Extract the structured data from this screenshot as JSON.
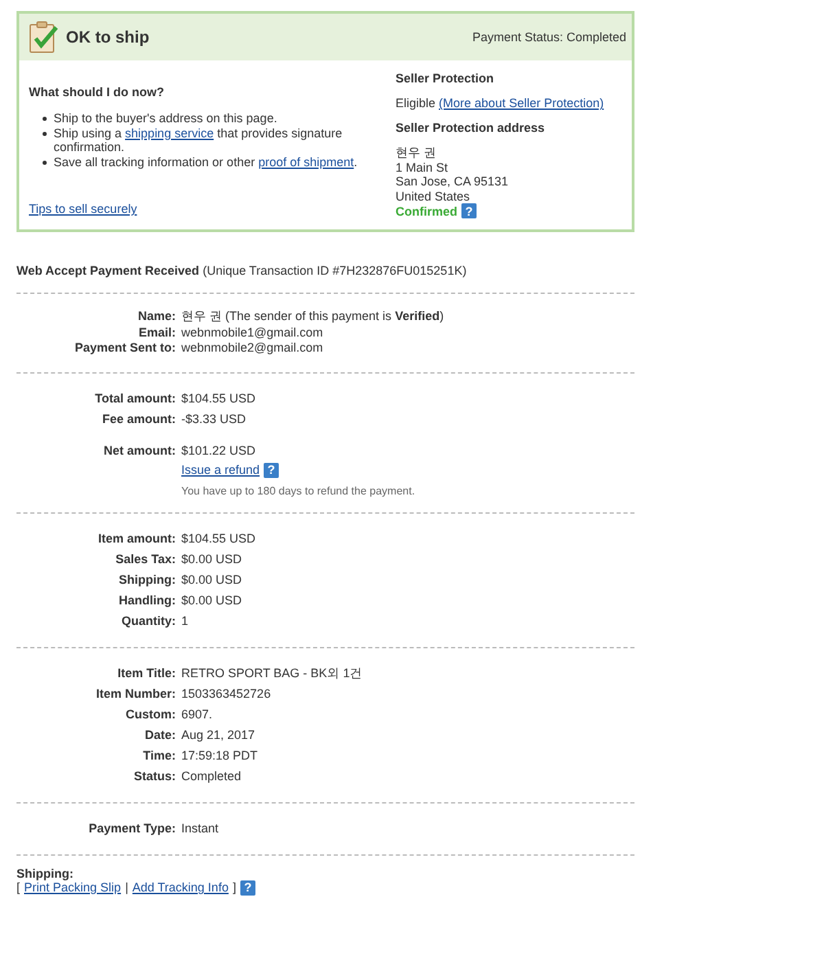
{
  "status_box": {
    "title": "OK to ship",
    "payment_status": "Payment Status: Completed",
    "question": "What should I do now?",
    "steps": [
      [
        {
          "kind": "text",
          "text": "Ship to the buyer's address on this page."
        }
      ],
      [
        {
          "kind": "text",
          "text": "Ship using a "
        },
        {
          "kind": "link",
          "text": "shipping service"
        },
        {
          "kind": "text",
          "text": " that provides signature confirmation."
        }
      ],
      [
        {
          "kind": "text",
          "text": "Save all tracking information or other "
        },
        {
          "kind": "link",
          "text": "proof of shipment"
        },
        {
          "kind": "text",
          "text": "."
        }
      ]
    ],
    "tips_link": "Tips to sell securely",
    "protection": {
      "heading": "Seller Protection",
      "status": "Eligible",
      "more_link": "(More about Seller Protection)",
      "address_heading": "Seller Protection address",
      "address_lines": [
        "현우 권",
        "1 Main St",
        "San Jose, CA 95131",
        "United States"
      ],
      "confirmed": "Confirmed",
      "help": "?"
    }
  },
  "transaction": {
    "title": "Web Accept Payment Received",
    "id_text": "(Unique Transaction ID #7H232876FU015251K)"
  },
  "sections": [
    {
      "groups": [
        [
          {
            "label": "Name:",
            "value": "현우 권 (The sender of this payment is **Verified**)"
          },
          {
            "label": "Email:",
            "value": "webnmobile1@gmail.com"
          },
          {
            "label": "Payment Sent to:",
            "value": "webnmobile2@gmail.com"
          }
        ]
      ],
      "compact": true
    },
    {
      "groups": [
        [
          {
            "label": "Total amount:",
            "value": "$104.55 USD"
          },
          {
            "label": "Fee amount:",
            "value": "-$3.33 USD"
          }
        ],
        [
          {
            "label": "Net amount:",
            "value": "$101.22 USD"
          }
        ]
      ],
      "refund": {
        "link": "Issue a refund",
        "help": "?",
        "note": "You have up to 180 days to refund the payment."
      }
    },
    {
      "groups": [
        [
          {
            "label": "Item amount:",
            "value": "$104.55 USD"
          },
          {
            "label": "Sales Tax:",
            "value": "$0.00 USD"
          },
          {
            "label": "Shipping:",
            "value": "$0.00 USD"
          },
          {
            "label": "Handling:",
            "value": "$0.00 USD"
          },
          {
            "label": "Quantity:",
            "value": "1"
          }
        ]
      ]
    },
    {
      "groups": [
        [
          {
            "label": "Item Title:",
            "value": "RETRO SPORT BAG - BK외 1건"
          },
          {
            "label": "Item Number:",
            "value": "1503363452726"
          },
          {
            "label": "Custom:",
            "value": "6907."
          },
          {
            "label": "Date:",
            "value": "Aug 21, 2017"
          },
          {
            "label": "Time:",
            "value": "17:59:18 PDT"
          },
          {
            "label": "Status:",
            "value": "Completed"
          }
        ]
      ]
    },
    {
      "groups": [
        [
          {
            "label": "Payment Type:",
            "value": "Instant"
          }
        ]
      ]
    }
  ],
  "shipping": {
    "heading": "Shipping:",
    "open": "[",
    "links": [
      "Print Packing Slip",
      "Add Tracking Info"
    ],
    "separator": "|",
    "close": "]",
    "help": "?"
  }
}
